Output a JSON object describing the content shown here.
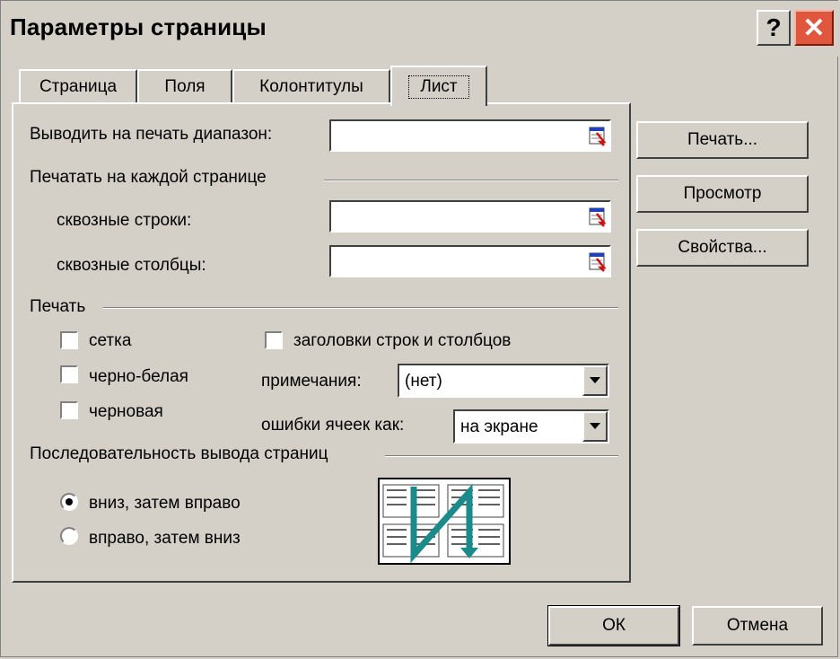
{
  "window": {
    "title": "Параметры страницы",
    "help_label": "?",
    "close_label": "✕"
  },
  "tabs": [
    {
      "label": "Страница"
    },
    {
      "label": "Поля"
    },
    {
      "label": "Колонтитулы"
    },
    {
      "label": "Лист"
    }
  ],
  "print_area": {
    "label": "Выводить на печать диапазон:",
    "value": ""
  },
  "repeat": {
    "heading": "Печатать на каждой странице",
    "rows_label": "сквозные строки:",
    "rows_value": "",
    "cols_label": "сквозные столбцы:",
    "cols_value": ""
  },
  "print": {
    "heading": "Печать",
    "grid_label": "сетка",
    "bw_label": "черно-белая",
    "draft_label": "черновая",
    "headers_label": "заголовки строк и столбцов",
    "comments_label": "примечания:",
    "comments_value": "(нет)",
    "errors_label": "ошибки ячеек как:",
    "errors_value": "на экране",
    "grid_checked": false,
    "bw_checked": false,
    "draft_checked": false,
    "headers_checked": false
  },
  "order": {
    "heading": "Последовательность вывода страниц",
    "down_then_over": "вниз, затем вправо",
    "over_then_down": "вправо, затем вниз",
    "selected": "down_then_over"
  },
  "side_buttons": {
    "print": "Печать...",
    "preview": "Просмотр",
    "options": "Свойства..."
  },
  "footer": {
    "ok": "ОК",
    "cancel": "Отмена"
  },
  "colors": {
    "face": "#d4d0c8",
    "close_red": "#e0573d",
    "arrow_teal": "#1a8a8a"
  }
}
